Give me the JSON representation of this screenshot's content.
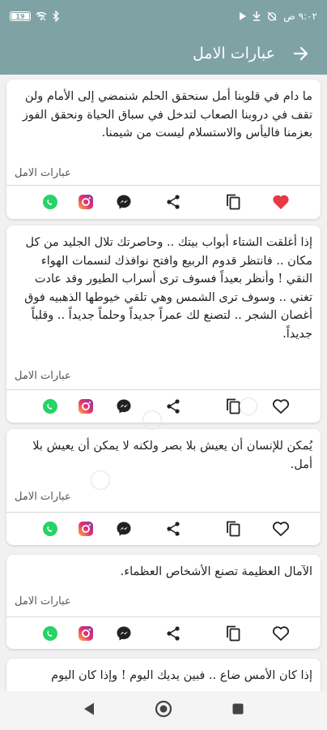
{
  "status_bar": {
    "time": "٩:٠٢ ص",
    "battery": "19"
  },
  "app_bar": {
    "title": "عبارات الامل"
  },
  "cards": [
    {
      "text": "ما دام في قلوبنا أمل سنحقق الحلم شنمضي إلى الأمام ولن تقف في دروبنا الصعاب لتدخل في سباق الحياة ونحقق الفوز بعزمنا فاليأس والاستسلام ليست من شيمنا.",
      "tag": "عبارات الامل",
      "favorited": true
    },
    {
      "text": "إذا أغلقت الشتاء أبواب بيتك .. وحاصرتك تلال الجليد من كل مكان .. فانتظر قدوم الربيع وافتح نوافذك لنسمات الهواء النقي ! وأنظر بعيداً فسوف ترى أسراب الطيور وقد عادت تغني .. وسوف ترى الشمس وهي تلقي خيوطها الذهبيه فوق أغصان الشجر .. لتصنع لك عمراً جديداً وحلماً جديداً .. وقلباً جديداً.",
      "tag": "عبارات الامل",
      "favorited": false
    },
    {
      "text": "يُمكن للإنسان أن يعيش بلا بصر ولكنه لا يمكن أن يعيش بلا أمل.",
      "tag": "عبارات الامل",
      "favorited": false
    },
    {
      "text": "الآمال العظيمة تصنع الأشخاص العظماء.",
      "tag": "عبارات الامل",
      "favorited": false
    },
    {
      "text": "إذا كان الأمس ضاع .. فبين يديك اليوم ! وإذا كان اليوم",
      "tag": "",
      "favorited": false
    }
  ],
  "colors": {
    "app_bar": "#7fa3a5",
    "heart_active": "#e53945",
    "whatsapp": "#25d366"
  }
}
